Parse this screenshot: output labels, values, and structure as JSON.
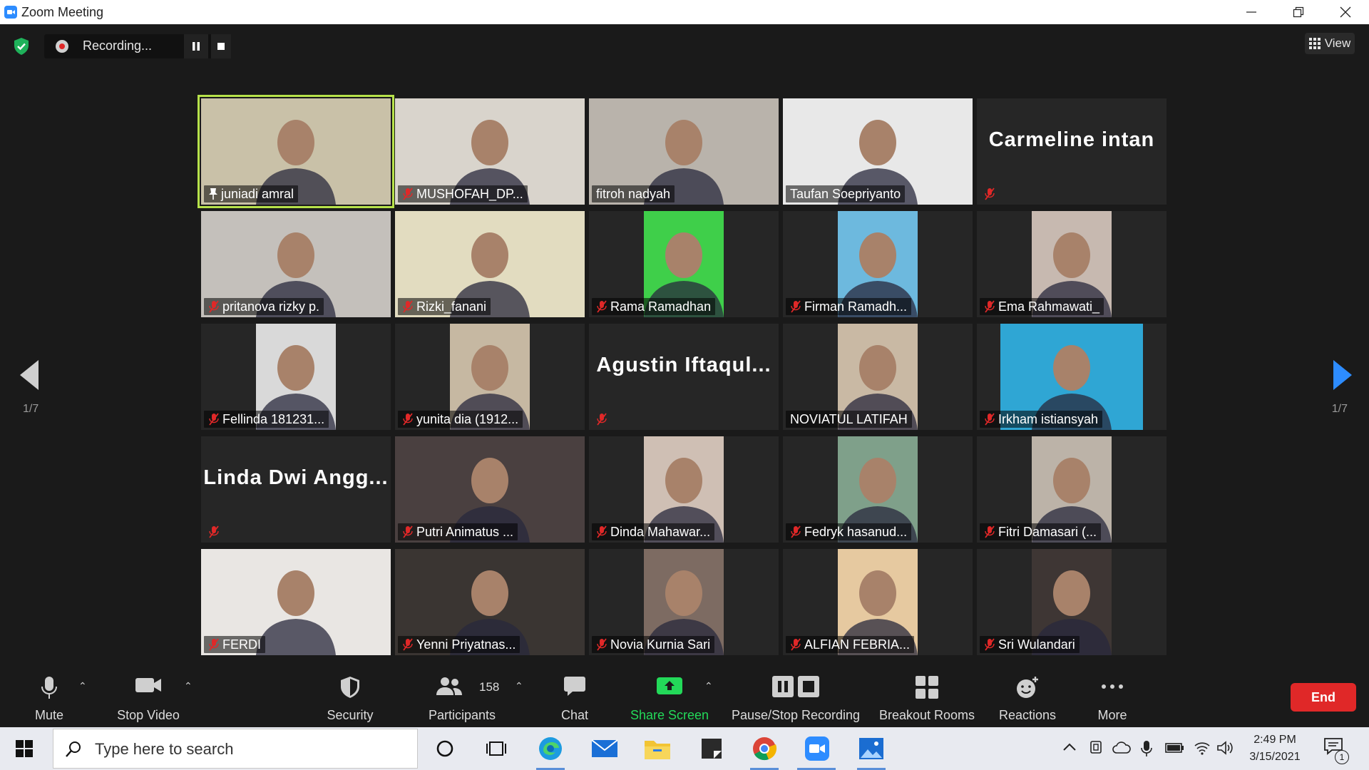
{
  "window": {
    "title": "Zoom Meeting"
  },
  "recording": {
    "status": "Recording..."
  },
  "view_button": {
    "label": "View"
  },
  "pagination": {
    "left": "1/7",
    "right": "1/7"
  },
  "participants_grid": [
    {
      "name": "juniadi amral",
      "muted": false,
      "active": true,
      "pin": true,
      "bg": "#c9c1a8",
      "video_w": 266
    },
    {
      "name": "MUSHOFAH_DP...",
      "muted": true,
      "bg": "#d9d4cc",
      "video_w": 266
    },
    {
      "name": "fitroh nadyah",
      "muted": false,
      "bg": "#b9b3ab",
      "video_w": 266
    },
    {
      "name": "Taufan Soepriyanto",
      "muted": false,
      "bg": "#e8e8e8",
      "video_w": 266
    },
    {
      "name": "Carmeline intan",
      "muted": true,
      "name_only": true,
      "display_name": "Carmeline intan"
    },
    {
      "name": "pritanova rizky p.",
      "muted": true,
      "bg": "#c4c0bb",
      "video_w": 266
    },
    {
      "name": "Rizki_fanani",
      "muted": true,
      "bg": "#e2dcc0",
      "video_w": 266
    },
    {
      "name": "Rama Ramadhan",
      "muted": true,
      "bg": "#3fcf4a",
      "video_w": 112
    },
    {
      "name": "Firman Ramadh...",
      "muted": true,
      "bg": "#6db9de",
      "video_w": 112
    },
    {
      "name": "Ema Rahmawati_",
      "muted": true,
      "bg": "#c7b9b0",
      "video_w": 112
    },
    {
      "name": "Fellinda 181231...",
      "muted": true,
      "bg": "#d9d9d9",
      "video_w": 112
    },
    {
      "name": "yunita dia (1912...",
      "muted": true,
      "bg": "#c6b8a2",
      "video_w": 112
    },
    {
      "name": "Agustin Iftaqul...",
      "muted": true,
      "name_only": true,
      "display_name": "Agustin  Iftaqul..."
    },
    {
      "name": "NOVIATUL LATIFAH",
      "muted": false,
      "bg": "#c9b9a4",
      "video_w": 112
    },
    {
      "name": "Irkham istiansyah",
      "muted": true,
      "bg": "#2fa6d4",
      "video_w": 200
    },
    {
      "name": "Linda Dwi Angg...",
      "muted": true,
      "name_only": true,
      "display_name": "Linda  Dwi  Angg..."
    },
    {
      "name": "Putri Animatus ...",
      "muted": true,
      "bg": "#4a4040",
      "video_w": 266
    },
    {
      "name": "Dinda Mahawar...",
      "muted": true,
      "bg": "#cfbfb4",
      "video_w": 112
    },
    {
      "name": "Fedryk hasanud...",
      "muted": true,
      "bg": "#7fa08a",
      "video_w": 112
    },
    {
      "name": "Fitri Damasari (...",
      "muted": true,
      "bg": "#bcb3a8",
      "video_w": 112
    },
    {
      "name": "FERDI",
      "muted": true,
      "bg": "#e9e6e3",
      "video_w": 266
    },
    {
      "name": "Yenni Priyatnas...",
      "muted": true,
      "bg": "#3a3532",
      "video_w": 266
    },
    {
      "name": "Novia Kurnia Sari",
      "muted": true,
      "bg": "#7d6b62",
      "video_w": 112
    },
    {
      "name": "ALFIAN FEBRIA...",
      "muted": true,
      "bg": "#e6c9a0",
      "video_w": 112
    },
    {
      "name": "Sri Wulandari",
      "muted": true,
      "bg": "#3e3634",
      "video_w": 112
    }
  ],
  "toolbar": {
    "mute": "Mute",
    "stop_video": "Stop Video",
    "security": "Security",
    "participants": "Participants",
    "participants_count": "158",
    "chat": "Chat",
    "share_screen": "Share Screen",
    "pause_stop_recording": "Pause/Stop Recording",
    "breakout_rooms": "Breakout Rooms",
    "reactions": "Reactions",
    "more": "More",
    "end": "End"
  },
  "colors": {
    "share_green": "#23d959",
    "end_red": "#e02828",
    "active_speaker": "#b7e24a",
    "muted_red": "#e02828"
  },
  "taskbar": {
    "search_placeholder": "Type here to search",
    "time": "2:49 PM",
    "date": "3/15/2021",
    "notification_count": "1"
  }
}
